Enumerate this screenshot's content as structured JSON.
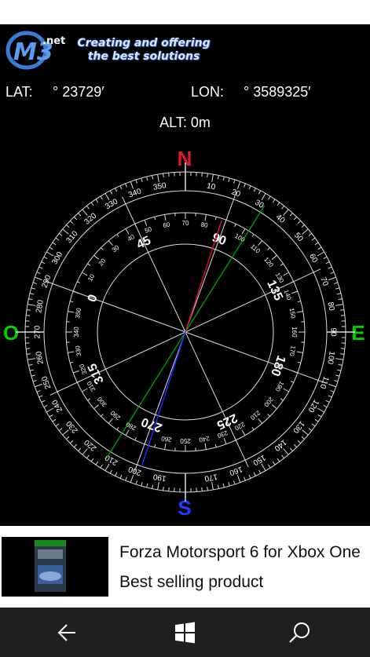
{
  "header": {
    "logo_text": "M3",
    "logo_suffix": ".net",
    "tagline_line1": "Creating and offering",
    "tagline_line2": "the best solutions"
  },
  "location": {
    "lat_label": "LAT:",
    "lat_value": "° 23729′",
    "lon_label": "LON:",
    "lon_value": "° 3589325′",
    "alt_text": "ALT: 0m"
  },
  "compass": {
    "north": "N",
    "south": "S",
    "east": "E",
    "west": "O",
    "outer_labels": [
      "10",
      "20",
      "30",
      "40",
      "50",
      "60",
      "70",
      "80",
      "90",
      "100",
      "110",
      "120",
      "130",
      "140",
      "150",
      "160",
      "170",
      "190",
      "200",
      "210",
      "220",
      "230",
      "240",
      "250",
      "260",
      "270",
      "280",
      "290",
      "300",
      "310",
      "320",
      "330",
      "340",
      "350"
    ],
    "inner_small_labels": [
      "10",
      "20",
      "30",
      "40",
      "50",
      "60",
      "70",
      "80",
      "100",
      "110",
      "120",
      "130",
      "140",
      "150",
      "160",
      "170",
      "190",
      "200",
      "210",
      "220",
      "230",
      "240",
      "250",
      "260",
      "280",
      "290",
      "300",
      "310",
      "320",
      "330",
      "340",
      "350"
    ],
    "inner_big_labels": [
      "0",
      "45",
      "90",
      "135",
      "180",
      "225",
      "270",
      "315"
    ],
    "colors": {
      "north": "#e0182a",
      "south": "#1a3cff",
      "east": "#00d000",
      "west": "#00d000",
      "red_needle": "#d01020",
      "blue_needle": "#1a2cff",
      "green_line": "#00b000"
    }
  },
  "ad": {
    "title": "Forza Motorsport 6 for Xbox One",
    "subtitle": "Best selling product"
  },
  "navbar": {
    "back_icon": "back-arrow-icon",
    "windows_icon": "windows-logo-icon",
    "search_icon": "search-icon"
  }
}
